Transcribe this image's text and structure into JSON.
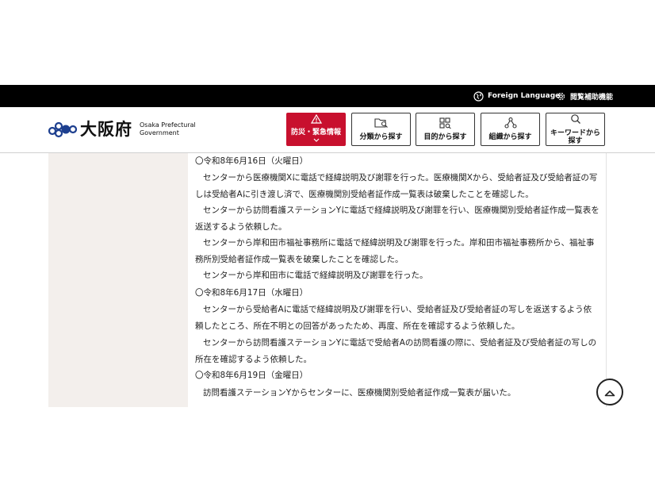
{
  "topbar": {
    "foreign_language_label": "Foreign Language",
    "accessibility_label": "閲覧補助機能"
  },
  "header": {
    "logo_kanji": "大阪府",
    "logo_en_line1": "Osaka Prefectural",
    "logo_en_line2": "Government",
    "nav": {
      "disaster_label": "防災・緊急情報",
      "category_label": "分類から探す",
      "purpose_label": "目的から探す",
      "organization_label": "組織から探す",
      "keyword_label_line1": "キーワードから",
      "keyword_label_line2": "探す"
    }
  },
  "content": {
    "paragraphs": [
      "〇令和8年6月16日（火曜日）",
      "センターから医療機関Xに電話で経緯説明及び謝罪を行った。医療機関Xから、受給者証及び受給者証の写しは受給者Aに引き渡し済で、医療機関別受給者証作成一覧表は破棄したことを確認した。",
      "センターから訪問看護ステーションYに電話で経緯説明及び謝罪を行い、医療機関別受給者証作成一覧表を返送するよう依頼した。",
      "センターから岸和田市福祉事務所に電話で経緯説明及び謝罪を行った。岸和田市福祉事務所から、福祉事務所別受給者証作成一覧表を破棄したことを確認した。",
      "センターから岸和田市に電話で経緯説明及び謝罪を行った。",
      "〇令和8年6月17日（水曜日）",
      "センターから受給者Aに電話で経緯説明及び謝罪を行い、受給者証及び受給者証の写しを返送するよう依頼したところ、所在不明との回答があったため、再度、所在を確認するよう依頼した。",
      "センターから訪問看護ステーションYに電話で受給者Aの訪問看護の際に、受給者証及び受給者証の写しの所在を確認するよう依頼した。",
      "〇令和8年6月19日（金曜日）",
      "訪問看護ステーションYからセンターに、医療機関別受給者証作成一覧表が届いた。"
    ]
  },
  "colors": {
    "topbar_bg": "#000000",
    "disaster_red": "#c8102e",
    "sidebar_bg": "#f3efec"
  },
  "icons": [
    "globe-icon",
    "gear-icon",
    "warning-icon",
    "chevron-down-icon",
    "folder-search-icon",
    "grid-search-icon",
    "org-chart-icon",
    "search-icon",
    "chevron-up-icon"
  ]
}
